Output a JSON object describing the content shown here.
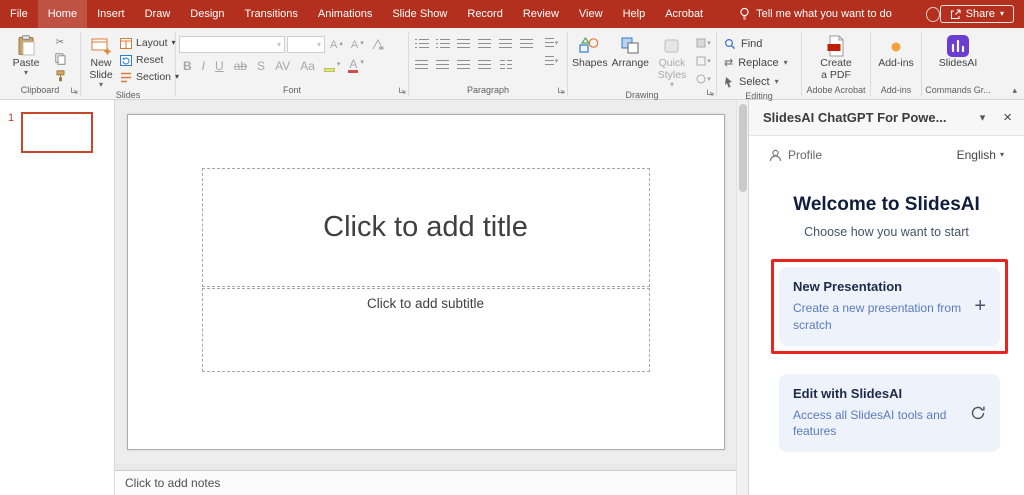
{
  "titlebar": {
    "tabs": [
      "File",
      "Home",
      "Insert",
      "Draw",
      "Design",
      "Transitions",
      "Animations",
      "Slide Show",
      "Record",
      "Review",
      "View",
      "Help",
      "Acrobat"
    ],
    "tell_me": "Tell me what you want to do",
    "share": "Share"
  },
  "ribbon": {
    "clipboard": {
      "paste": "Paste",
      "group": "Clipboard"
    },
    "slides": {
      "new_slide": "New Slide",
      "layout": "Layout",
      "reset": "Reset",
      "section": "Section",
      "group": "Slides"
    },
    "font": {
      "bold": "B",
      "italic": "I",
      "underline": "U",
      "shadow": "S",
      "strike": "ab",
      "spacing": "AV",
      "case": "Aa",
      "color": "A",
      "grow": "A",
      "shrink": "A",
      "group": "Font"
    },
    "paragraph": {
      "group": "Paragraph"
    },
    "drawing": {
      "shapes": "Shapes",
      "arrange": "Arrange",
      "quick_styles": "Quick Styles",
      "group": "Drawing"
    },
    "editing": {
      "find": "Find",
      "replace": "Replace",
      "select": "Select",
      "group": "Editing"
    },
    "acrobat": {
      "create_pdf": "Create a PDF",
      "group": "Adobe Acrobat"
    },
    "addins": {
      "label": "Add-ins",
      "group": "Add-ins"
    },
    "commands": {
      "label": "SlidesAI",
      "group": "Commands Gr..."
    }
  },
  "thumbnails": {
    "slide_number": "1"
  },
  "slide": {
    "title_placeholder": "Click to add title",
    "subtitle_placeholder": "Click to add subtitle"
  },
  "notes": {
    "placeholder": "Click to add notes"
  },
  "panel": {
    "title": "SlidesAI ChatGPT For Powe...",
    "profile": "Profile",
    "language": "English",
    "welcome": "Welcome to SlidesAI",
    "subtitle": "Choose how you want to start",
    "cards": [
      {
        "title": "New Presentation",
        "desc": "Create a new presentation from scratch"
      },
      {
        "title": "Edit with SlidesAI",
        "desc": "Access all SlidesAI tools and features"
      }
    ]
  },
  "icons": {
    "chevron_down": "▾",
    "collapse_ribbon": "▴",
    "close": "×",
    "plus": "+",
    "scissors": "✂",
    "replace_arrows": "⇄"
  },
  "colors": {
    "titlebar_red": "#B3301E",
    "annotation_red": "#E8251D",
    "card_bg": "#EEF3FB",
    "slidesai_purple": "#6C3DD1",
    "addins_orange": "#F2A33C",
    "thumbnail_border": "#C8472B"
  }
}
